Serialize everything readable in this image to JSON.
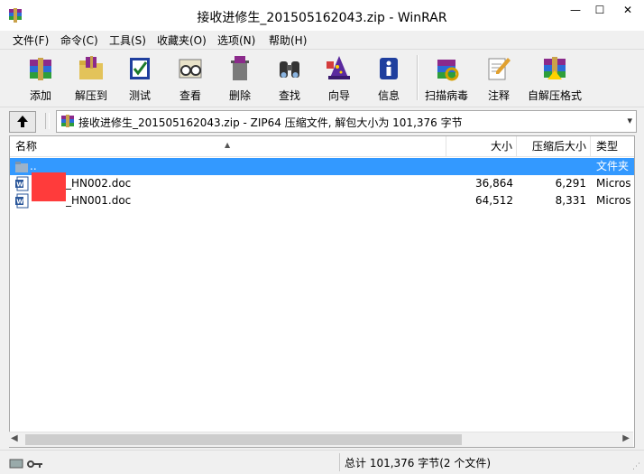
{
  "window": {
    "title": "接收进修生_201505162043.zip - WinRAR",
    "controls": {
      "minimize": "—",
      "maximize": "☐",
      "close": "✕"
    }
  },
  "menu": [
    "文件(F)",
    "命令(C)",
    "工具(S)",
    "收藏夹(O)",
    "选项(N)",
    "帮助(H)"
  ],
  "toolbar": {
    "add": "添加",
    "extract_to": "解压到",
    "test": "测试",
    "view": "查看",
    "delete": "删除",
    "find": "查找",
    "wizard": "向导",
    "info": "信息",
    "virus_scan": "扫描病毒",
    "comment": "注释",
    "sfx": "自解压格式"
  },
  "address": {
    "path": "接收进修生_201505162043.zip - ZIP64 压缩文件, 解包大小为 101,376 字节"
  },
  "columns": {
    "name": "名称",
    "size": "大小",
    "packed": "压缩后大小",
    "type": "类型"
  },
  "rows": [
    {
      "name": "..",
      "size": "",
      "packed": "",
      "type": "文件夹",
      "icon": "folder-icon",
      "selected": true
    },
    {
      "name": "_HN002.doc",
      "size": "36,864",
      "packed": "6,291",
      "type": "Micros",
      "icon": "word-doc-icon",
      "selected": false
    },
    {
      "name": "_HN001.doc",
      "size": "64,512",
      "packed": "8,331",
      "type": "Micros",
      "icon": "word-doc-icon",
      "selected": false
    }
  ],
  "status": {
    "summary": "总计 101,376 字节(2 个文件)"
  },
  "colors": {
    "selection": "#3399ff",
    "redaction": "#ff3b3b"
  }
}
